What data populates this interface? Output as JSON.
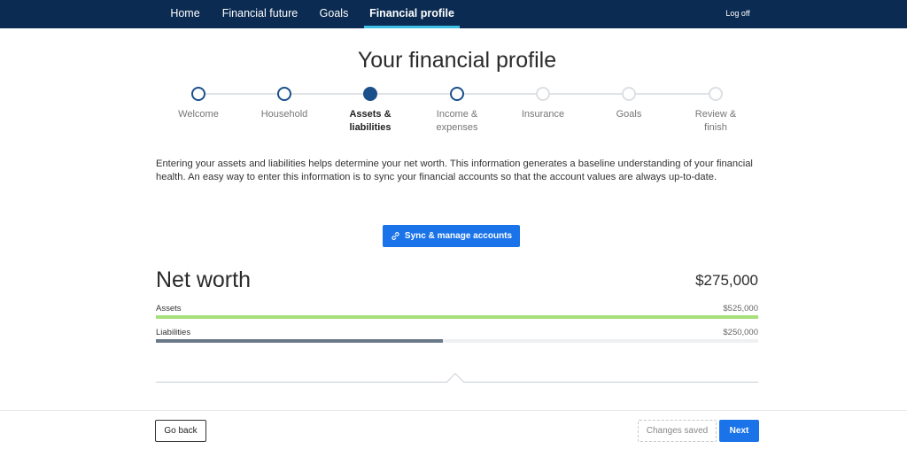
{
  "nav": {
    "items": [
      {
        "label": "Home"
      },
      {
        "label": "Financial future"
      },
      {
        "label": "Goals"
      },
      {
        "label": "Financial profile"
      }
    ],
    "logoff": "Log off"
  },
  "page_title": "Your financial profile",
  "stepper": {
    "steps": [
      {
        "line1": "Welcome",
        "line2": "",
        "status": "done"
      },
      {
        "line1": "Household",
        "line2": "",
        "status": "done"
      },
      {
        "line1": "Assets &",
        "line2": "liabilities",
        "status": "current"
      },
      {
        "line1": "Income &",
        "line2": "expenses",
        "status": "done"
      },
      {
        "line1": "Insurance",
        "line2": "",
        "status": "todo"
      },
      {
        "line1": "Goals",
        "line2": "",
        "status": "todo"
      },
      {
        "line1": "Review &",
        "line2": "finish",
        "status": "todo"
      }
    ]
  },
  "intro": "Entering your assets and liabilities helps determine your net worth. This information generates a baseline understanding of your financial health. An easy way to enter this information is to sync your financial accounts so that the account values are always up-to-date.",
  "sync_button": {
    "label": "Sync & manage accounts",
    "icon": "link-icon"
  },
  "net_worth": {
    "title": "Net worth",
    "value": "$275,000",
    "assets": {
      "label": "Assets",
      "value": "$525,000",
      "fill_fraction": 1.0,
      "color": "#a6e07a"
    },
    "liabilities": {
      "label": "Liabilities",
      "value": "$250,000",
      "fill_fraction": 0.476,
      "color": "#6b7889"
    }
  },
  "footer": {
    "go_back": "Go back",
    "changes_saved": "Changes saved",
    "next": "Next"
  },
  "colors": {
    "nav_bg": "#0b2b52",
    "active_underline": "#3ec0e6",
    "primary": "#1a73e8",
    "step_done": "#1a4f8b"
  }
}
